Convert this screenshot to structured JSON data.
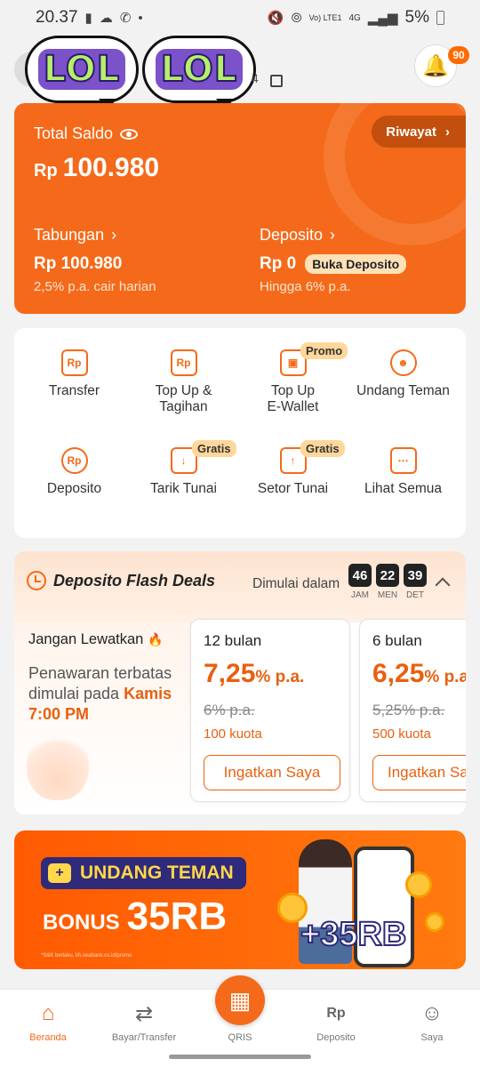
{
  "status_bar": {
    "time": "20.37",
    "left_icons": [
      "alert-icon",
      "cloud-icon",
      "whatsapp-icon",
      "dot"
    ],
    "right_icons": [
      "mute-icon",
      "hotspot-icon",
      "volte-icon",
      "4g-icon",
      "signal-icon",
      "signal-icon-2"
    ],
    "network": "Vo) LTE1",
    "network_gen": "4G",
    "battery": "5%"
  },
  "header": {
    "sticker_text": "LOL",
    "number_suffix": "4",
    "notif_count": "90"
  },
  "balance": {
    "label": "Total Saldo",
    "currency": "Rp",
    "amount": "100.980",
    "history_label": "Riwayat",
    "savings": {
      "label": "Tabungan",
      "value": "Rp 100.980",
      "note": "2,5% p.a. cair harian"
    },
    "deposit": {
      "label": "Deposito",
      "value": "Rp 0",
      "badge": "Buka Deposito",
      "note": "Hingga 6% p.a."
    }
  },
  "menu": [
    {
      "label_1": "Transfer",
      "label_2": "",
      "icon": "transfer-icon",
      "tag": ""
    },
    {
      "label_1": "Top Up &",
      "label_2": "Tagihan",
      "icon": "bill-icon",
      "tag": ""
    },
    {
      "label_1": "Top Up",
      "label_2": "E-Wallet",
      "icon": "wallet-icon",
      "tag": "Promo"
    },
    {
      "label_1": "Undang Teman",
      "label_2": "",
      "icon": "invite-icon",
      "tag": ""
    },
    {
      "label_1": "Deposito",
      "label_2": "",
      "icon": "deposit-icon",
      "tag": ""
    },
    {
      "label_1": "Tarik Tunai",
      "label_2": "",
      "icon": "withdraw-icon",
      "tag": "Gratis"
    },
    {
      "label_1": "Setor Tunai",
      "label_2": "",
      "icon": "cash-deposit-icon",
      "tag": "Gratis"
    },
    {
      "label_1": "Lihat Semua",
      "label_2": "",
      "icon": "more-icon",
      "tag": ""
    }
  ],
  "flash_deals": {
    "title": "Deposito Flash Deals",
    "starts_label": "Dimulai dalam",
    "countdown": [
      {
        "value": "46",
        "unit": "JAM"
      },
      {
        "value": "22",
        "unit": "MEN"
      },
      {
        "value": "39",
        "unit": "DET"
      }
    ],
    "promo_title": "Jangan Lewatkan",
    "promo_emoji": "🔥",
    "promo_text": "Penawaran terbatas dimulai pada",
    "promo_day": "Kamis",
    "promo_time": "7:00 PM",
    "deals": [
      {
        "term": "12 bulan",
        "rate": "7,25",
        "rate_unit": "% p.a.",
        "old_rate": "6% p.a.",
        "quota": "100 kuota",
        "button": "Ingatkan Saya"
      },
      {
        "term": "6 bulan",
        "rate": "6,25",
        "rate_unit": "% p.a.",
        "old_rate": "5,25% p.a.",
        "quota": "500 kuota",
        "button": "Ingatkan Saya"
      }
    ]
  },
  "banner": {
    "heading": "UNDANG TEMAN",
    "bonus_label": "BONUS",
    "bonus_value": "35RB",
    "plus_value": "+35RB",
    "fine_print": "*S&K berlaku, lih.seabank.co.id/promo"
  },
  "bottom_nav": [
    {
      "label": "Beranda",
      "icon": "home-icon",
      "active": true
    },
    {
      "label": "Bayar/Transfer",
      "icon": "swap-icon",
      "active": false
    },
    {
      "label": "QRIS",
      "icon": "qr-icon",
      "active": false
    },
    {
      "label": "Deposito",
      "icon": "deposit-bag-icon",
      "active": false
    },
    {
      "label": "Saya",
      "icon": "person-icon",
      "active": false
    }
  ],
  "colors": {
    "brand_orange": "#f46a1a",
    "dark_orange": "#c24f0e",
    "badge_yellow": "#ffd79a",
    "banner_navy": "#2f2a7a"
  }
}
